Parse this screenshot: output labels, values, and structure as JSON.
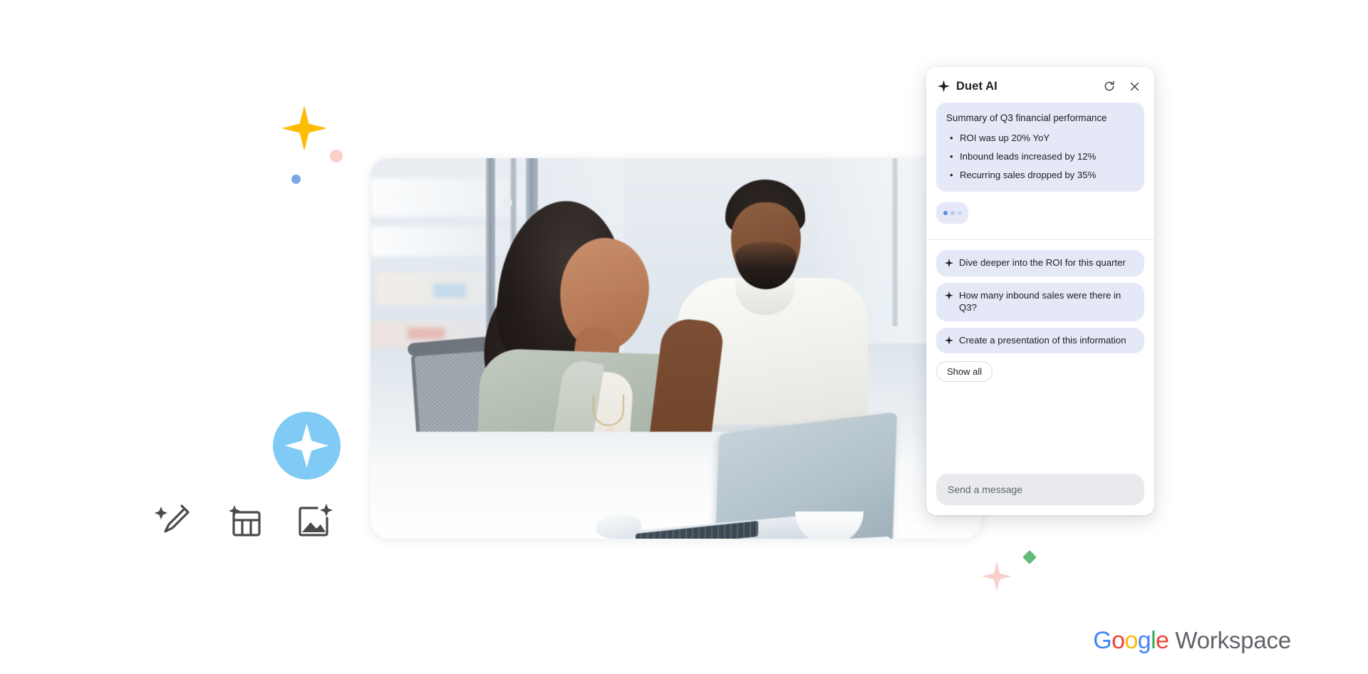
{
  "panel": {
    "title": "Duet AI",
    "header_icons": {
      "sparkle": "sparkle-icon",
      "refresh": "refresh-icon",
      "close": "close-icon"
    },
    "message": {
      "summary_title": "Summary of Q3 financial performance",
      "bullets": [
        "ROI was up 20% YoY",
        "Inbound leads increased by 12%",
        "Recurring sales dropped by 35%"
      ]
    },
    "typing_indicator": {
      "dots": 3,
      "active_color": "#5b8def",
      "idle_color": "#c2cdf0"
    },
    "suggestions": [
      "Dive deeper into the ROI for this quarter",
      "How many inbound sales were there in Q3?",
      "Create a presentation of this information"
    ],
    "show_all_label": "Show all",
    "composer": {
      "placeholder": "Send a message",
      "value": ""
    },
    "colors": {
      "bubble_bg": "#E4E8F7",
      "panel_bg": "#FFFFFF",
      "input_bg": "#E8EAEE"
    }
  },
  "feature_icons": [
    {
      "name": "magic-pencil-icon",
      "label": "Help me write"
    },
    {
      "name": "table-sparkle-icon",
      "label": "Help me organize"
    },
    {
      "name": "image-sparkle-icon",
      "label": "Help me visualize"
    }
  ],
  "decorations": {
    "ai_badge": {
      "name": "ai-sparkle-badge",
      "circle_color": "#7FCBF5",
      "star_color": "#FFFFFF"
    },
    "star_yellow": "#FBBC04",
    "dot_pink": "#F9CFCA",
    "dot_blue": "#7BA7E8",
    "star_pink": "#F7CFCB",
    "diamond_green": "#34A853"
  },
  "photo": {
    "alt": "Two colleagues smiling at a laptop in a bright office by a window"
  },
  "branding": {
    "google": {
      "letters": [
        {
          "ch": "G",
          "color": "#4285F4"
        },
        {
          "ch": "o",
          "color": "#EA4335"
        },
        {
          "ch": "o",
          "color": "#FBBC04"
        },
        {
          "ch": "g",
          "color": "#4285F4"
        },
        {
          "ch": "l",
          "color": "#34A853"
        },
        {
          "ch": "e",
          "color": "#EA4335"
        }
      ]
    },
    "product": "Workspace",
    "product_color": "#5F6368"
  }
}
